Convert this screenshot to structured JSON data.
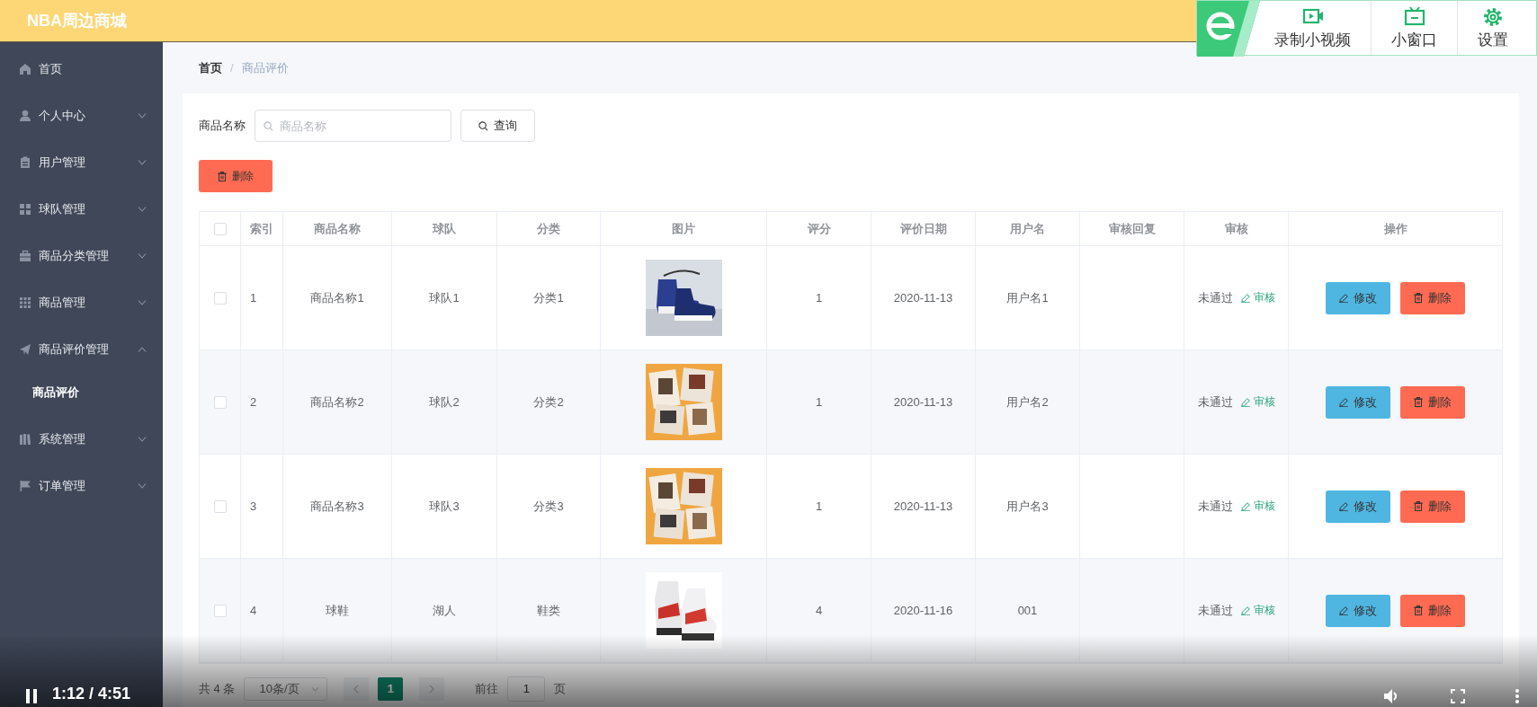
{
  "header": {
    "title": "NBA周边商城"
  },
  "recorder": {
    "buttons": [
      {
        "label": "录制小视频",
        "kind": "record"
      },
      {
        "label": "小窗口",
        "kind": "window"
      },
      {
        "label": "设置",
        "kind": "settings"
      }
    ]
  },
  "sidebar": {
    "items": [
      {
        "label": "首页",
        "kind": "link"
      },
      {
        "label": "个人中心",
        "kind": "group",
        "expanded": false
      },
      {
        "label": "用户管理",
        "kind": "group",
        "expanded": false
      },
      {
        "label": "球队管理",
        "kind": "group",
        "expanded": false
      },
      {
        "label": "商品分类管理",
        "kind": "group",
        "expanded": false
      },
      {
        "label": "商品管理",
        "kind": "group",
        "expanded": false
      },
      {
        "label": "商品评价管理",
        "kind": "group",
        "expanded": true,
        "children": [
          {
            "label": "商品评价",
            "selected": true
          }
        ]
      },
      {
        "label": "系统管理",
        "kind": "group",
        "expanded": false
      },
      {
        "label": "订单管理",
        "kind": "group",
        "expanded": false
      }
    ]
  },
  "breadcrumb": {
    "separator": "/",
    "items": [
      {
        "label": "首页",
        "current": false
      },
      {
        "label": "商品评价",
        "current": true
      }
    ]
  },
  "search": {
    "label": "商品名称",
    "placeholder": "商品名称",
    "button": "查询"
  },
  "delete_button": "删除",
  "table": {
    "select_all": {
      "checked": false
    },
    "columns": [
      "索引",
      "商品名称",
      "球队",
      "分类",
      "图片",
      "评分",
      "评价日期",
      "用户名",
      "审核回复",
      "审核",
      "操作"
    ],
    "rows": [
      {
        "checked": false,
        "index": "1",
        "name": "商品名称1",
        "team": "球队1",
        "category": "分类1",
        "picture": {
          "kind": "picture"
        },
        "score": "1",
        "date": "2020-11-13",
        "user": "用户名1",
        "status": "未通过",
        "review": "审核",
        "actions": [
          "修改",
          "删除"
        ]
      },
      {
        "checked": false,
        "index": "2",
        "name": "商品名称2",
        "team": "球队2",
        "category": "分类2",
        "picture": {
          "kind": "picture"
        },
        "score": "1",
        "date": "2020-11-13",
        "user": "用户名2",
        "status": "未通过",
        "review": "审核",
        "actions": [
          "修改",
          "删除"
        ]
      },
      {
        "checked": false,
        "index": "3",
        "name": "商品名称3",
        "team": "球队3",
        "category": "分类3",
        "picture": {
          "kind": "picture"
        },
        "score": "1",
        "date": "2020-11-13",
        "user": "用户名3",
        "status": "未通过",
        "review": "审核",
        "actions": [
          "修改",
          "删除"
        ]
      },
      {
        "checked": false,
        "index": "4",
        "name": "球鞋",
        "team": "湖人",
        "category": "鞋类",
        "picture": {
          "kind": "picture"
        },
        "score": "4",
        "date": "2020-11-16",
        "user": "001",
        "status": "未通过",
        "review": "审核",
        "actions": [
          "修改",
          "删除"
        ]
      }
    ]
  },
  "pagination": {
    "total": "共 4 条",
    "page_size": "10条/页",
    "pages": [
      {
        "label": "1",
        "selected": true
      }
    ],
    "goto_label": "前往",
    "goto_value": "1",
    "goto_suffix": "页"
  },
  "video_player": {
    "playing": true,
    "time": "1:12 / 4:51"
  }
}
